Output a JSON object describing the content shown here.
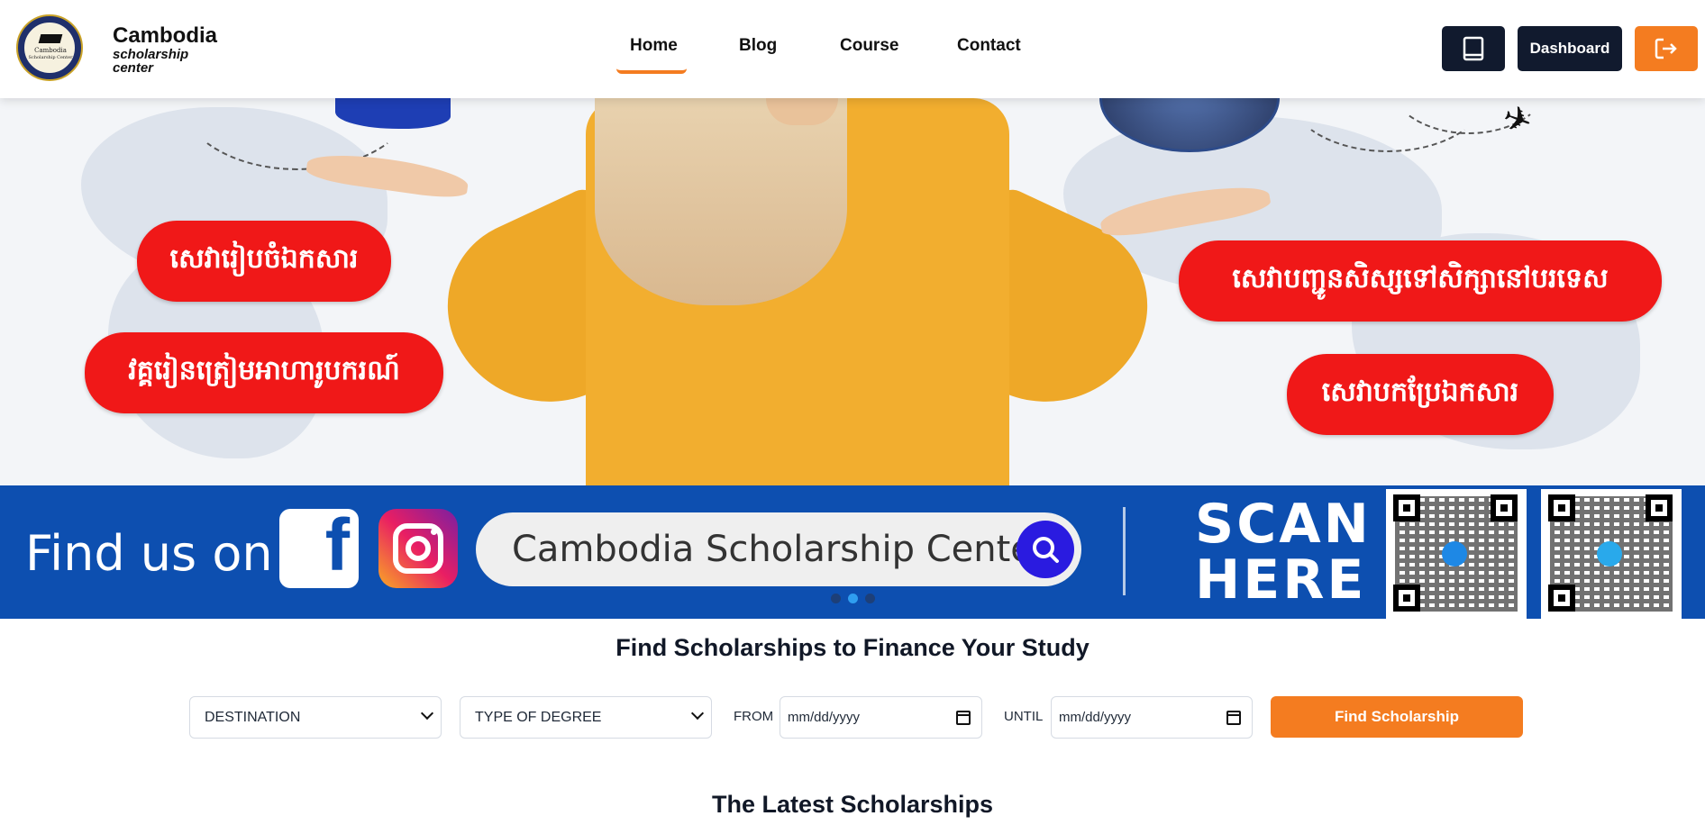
{
  "brand": {
    "name": "Cambodia",
    "sub1": "scholarship",
    "sub2": "center",
    "seal_text1": "Cambodia",
    "seal_text2": "Scholarship Center"
  },
  "nav": {
    "items": [
      {
        "label": "Home",
        "active": true
      },
      {
        "label": "Blog",
        "active": false
      },
      {
        "label": "Course",
        "active": false
      },
      {
        "label": "Contact",
        "active": false
      }
    ]
  },
  "header_actions": {
    "book_icon": "book-icon",
    "dashboard_label": "Dashboard",
    "logout_icon": "logout-icon"
  },
  "hero": {
    "pills_left": [
      "សេវារៀបចំឯកសារ",
      "វគ្គរៀនត្រៀមអាហារូបករណ៍"
    ],
    "pills_right": [
      "សេវាបញ្ជូនសិស្សទៅសិក្សានៅបរទេស",
      "សេវាបកប្រែឯកសារ"
    ],
    "find_us": "Find us on",
    "search_text": "Cambodia Scholarship Center",
    "scan_line1": "SCAN",
    "scan_line2": "HERE",
    "carousel_dots": 3,
    "active_dot": 1
  },
  "search_section": {
    "title": "Find Scholarships to Finance Your Study",
    "destination": "DESTINATION",
    "degree": "TYPE OF DEGREE",
    "from_label": "FROM",
    "until_label": "UNTIL",
    "from_placeholder": "mm/dd/yyyy",
    "until_placeholder": "mm/dd/yyyy",
    "button": "Find Scholarship"
  },
  "latest": {
    "title": "The Latest Scholarships"
  },
  "colors": {
    "accent": "#f47c20",
    "dark": "#111a2e",
    "band_blue": "#0d4fb0",
    "pill_red": "#f01818"
  }
}
